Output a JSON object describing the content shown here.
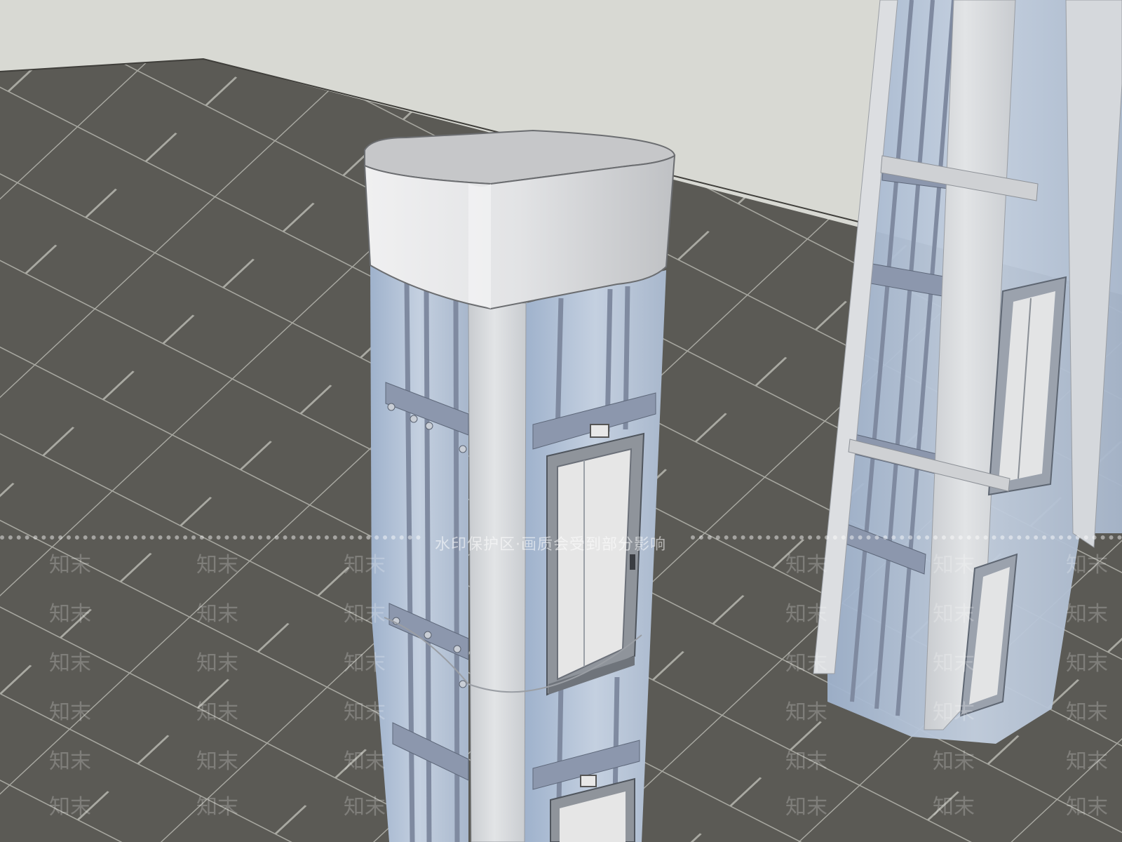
{
  "scene": {
    "subject": "Glass-walled observation elevator shafts on a tiled floor",
    "colors": {
      "sky": "#d8d9d3",
      "floor": "#5b5a55",
      "floor_line": "#a9a9a2",
      "glass": "#aebfd4",
      "frame": "#8f9bb0",
      "pillar": "#d7d9dc",
      "cap": "#e4e5e7"
    }
  },
  "watermark": {
    "banner": "水印保护区·画质会受到部分影响",
    "tile_text": "知末"
  }
}
